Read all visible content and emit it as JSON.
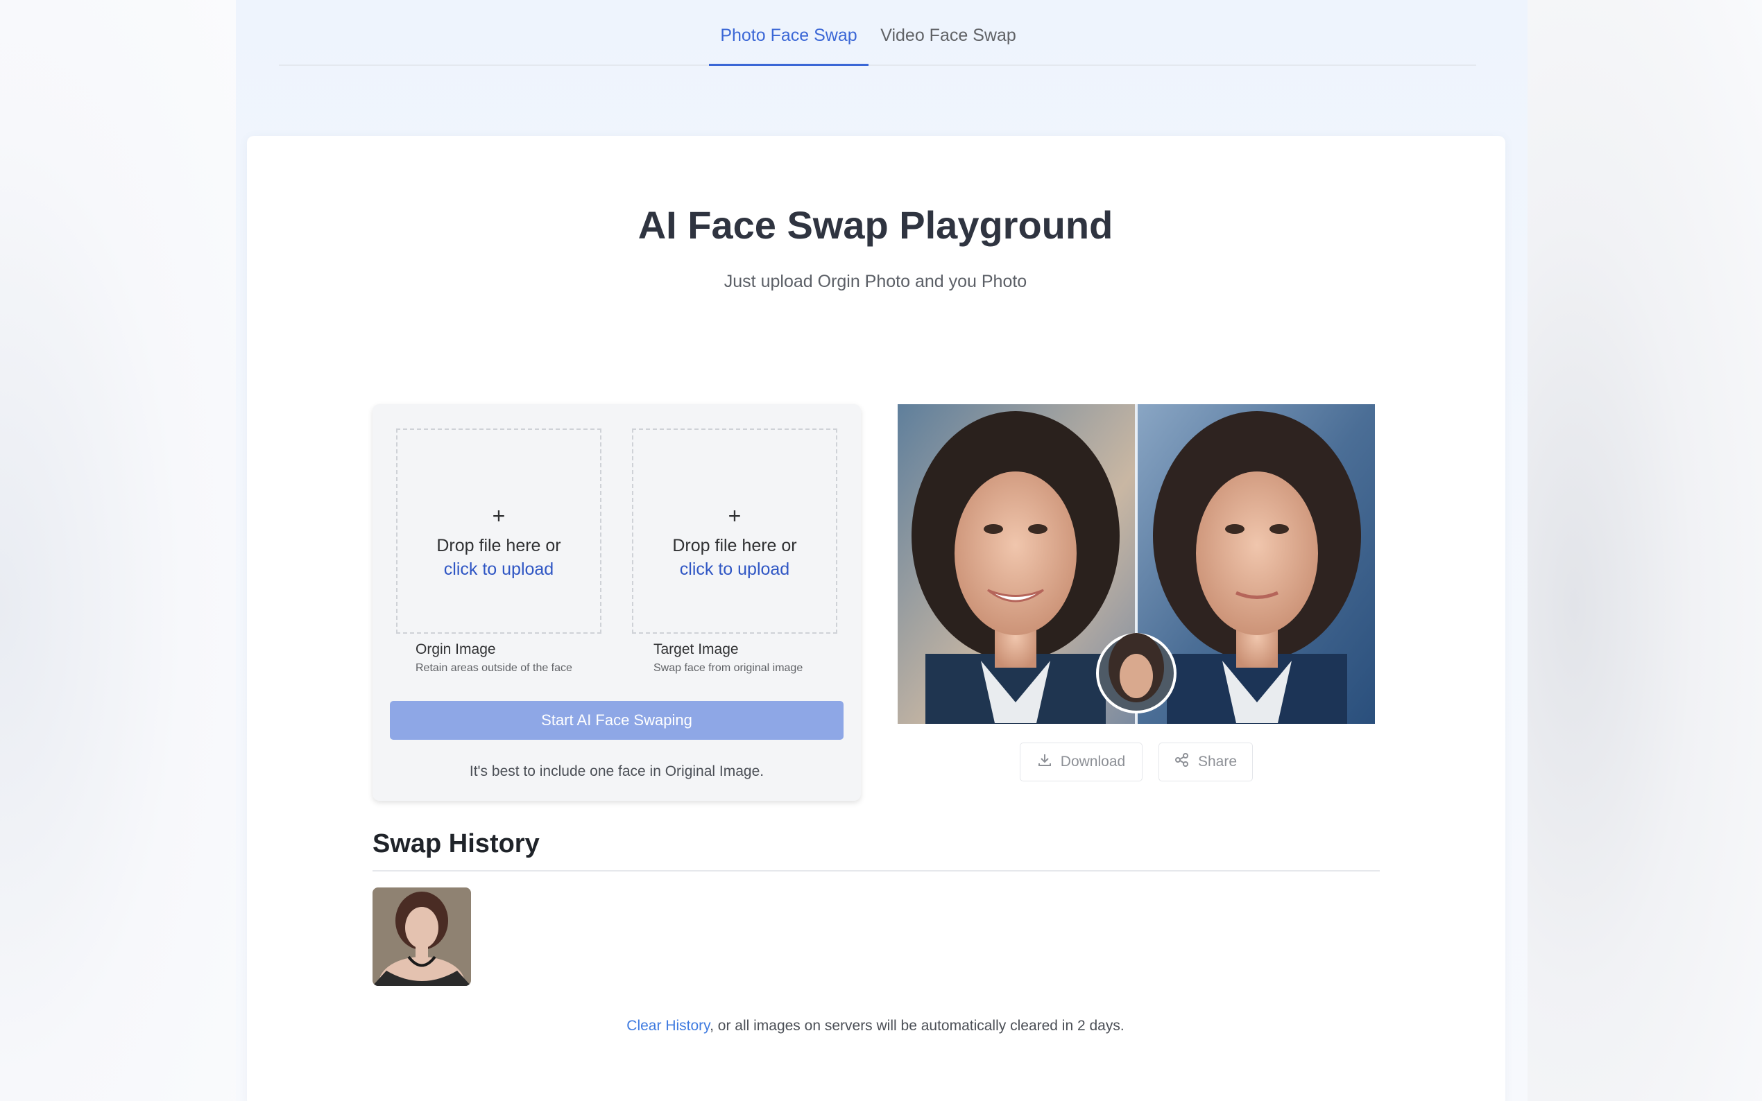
{
  "tabs": [
    {
      "label": "Photo Face Swap",
      "active": true
    },
    {
      "label": "Video Face Swap",
      "active": false
    }
  ],
  "hero": {
    "title": "AI Face Swap Playground",
    "subtitle": "Just upload Orgin Photo and you Photo"
  },
  "upload": {
    "origin": {
      "plus": "+",
      "drop_text": "Drop file here or",
      "link_text": "click to upload",
      "label": "Orgin Image",
      "sublabel": "Retain areas outside of the face"
    },
    "target": {
      "plus": "+",
      "drop_text": "Drop file here or",
      "link_text": "click to upload",
      "label": "Target Image",
      "sublabel": "Swap face from original image"
    },
    "start_button": "Start AI Face Swaping",
    "tip": "It's best to include one face in Original Image."
  },
  "preview": {
    "download_label": "Download",
    "share_label": "Share"
  },
  "history": {
    "title": "Swap History",
    "clear_link": "Clear History",
    "note": ", or all images on servers will be automatically cleared in 2 days."
  },
  "colors": {
    "accent": "#3b67d6",
    "link": "#2f56c4",
    "button_bg": "#8ea7e6",
    "clear_link": "#3f7be0"
  },
  "icons": {
    "download": "download-icon",
    "share": "share-icon"
  }
}
